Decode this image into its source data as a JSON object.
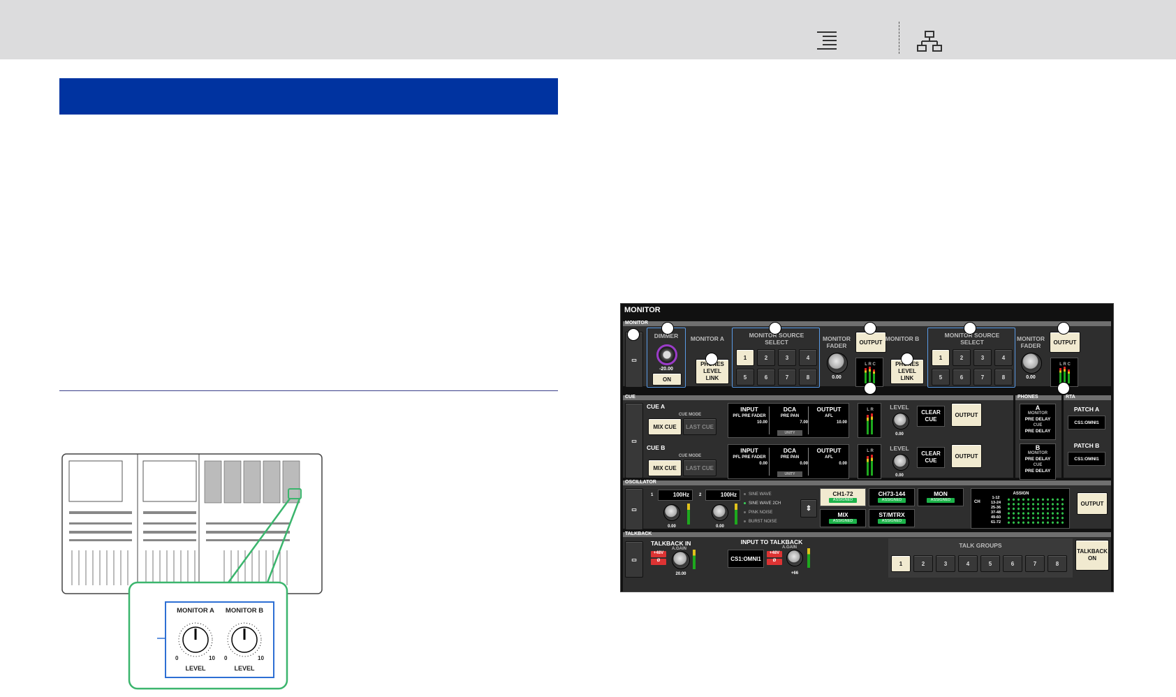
{
  "monitor": {
    "title": "MONITOR",
    "section_labels": {
      "monitor": "MONITOR",
      "cue": "CUE",
      "phones": "PHONES",
      "rta": "RTA",
      "oscillator": "OSCILLATOR",
      "talkback": "TALKBACK"
    },
    "dimmer": {
      "label": "DIMMER",
      "value": "-20.00",
      "on_label": "ON"
    },
    "monitor_a": {
      "label": "MONITOR A",
      "phones_link": "PHONES LEVEL LINK",
      "source_select_label": "MONITOR SOURCE SELECT",
      "sources": [
        "1",
        "2",
        "3",
        "4",
        "5",
        "6",
        "7",
        "8"
      ],
      "fader_label": "MONITOR FADER",
      "fader_value": "0.00",
      "output_label": "OUTPUT",
      "meter_label": "L R C"
    },
    "monitor_b": {
      "label": "MONITOR B",
      "phones_link": "PHONES LEVEL LINK",
      "source_select_label": "MONITOR SOURCE SELECT",
      "sources": [
        "1",
        "2",
        "3",
        "4",
        "5",
        "6",
        "7",
        "8"
      ],
      "fader_label": "MONITOR FADER",
      "fader_value": "0.00",
      "output_label": "OUTPUT",
      "meter_label": "L R C"
    },
    "cue_a": {
      "label": "CUE A",
      "mode_label": "CUE MODE",
      "mix_cue": "MIX CUE",
      "last_cue": "LAST CUE",
      "input_title": "INPUT",
      "input_sub": "PFL PRE FADER",
      "input_val": "10.00",
      "dca_title": "DCA",
      "dca_sub": "PRE PAN",
      "dca_val": "7.00",
      "unity": "UNITY",
      "output_title": "OUTPUT",
      "output_sub": "AFL",
      "output_val": "10.00",
      "meter_label": "L R",
      "level_label": "LEVEL",
      "level_value": "0.00",
      "clear_cue": "CLEAR CUE",
      "output_btn": "OUTPUT"
    },
    "cue_b": {
      "label": "CUE B",
      "mode_label": "CUE MODE",
      "mix_cue": "MIX CUE",
      "last_cue": "LAST CUE",
      "input_title": "INPUT",
      "input_sub": "PFL PRE FADER",
      "input_val": "0.00",
      "dca_title": "DCA",
      "dca_sub": "PRE PAN",
      "dca_val": "0.00",
      "unity": "UNITY",
      "output_title": "OUTPUT",
      "output_sub": "AFL",
      "output_val": "0.00",
      "meter_label": "L R",
      "level_label": "LEVEL",
      "level_value": "0.00",
      "clear_cue": "CLEAR CUE",
      "output_btn": "OUTPUT"
    },
    "phones": {
      "a": "A",
      "a_monitor": "MONITOR",
      "a_monitor_delay": "PRE DELAY",
      "a_cue": "CUE",
      "a_cue_delay": "PRE DELAY",
      "b": "B",
      "b_monitor": "MONITOR",
      "b_monitor_delay": "PRE DELAY",
      "b_cue": "CUE",
      "b_cue_delay": "PRE DELAY"
    },
    "rta": {
      "patch_a": "PATCH A",
      "patch_a_val": "CS1:OMNI1",
      "patch_b": "PATCH B",
      "patch_b_val": "CS1:OMNI1"
    },
    "oscillator": {
      "ch1_num": "1",
      "ch1_freq": "100Hz",
      "ch1_level": "0.00",
      "ch2_num": "2",
      "ch2_freq": "100Hz",
      "ch2_level": "0.00",
      "modes": [
        "SINE WAVE",
        "SINE WAVE 2CH",
        "PINK NOISE",
        "BURST NOISE"
      ],
      "groups": [
        {
          "name": "CH1-72",
          "tag": "ASSIGNED"
        },
        {
          "name": "CH73-144",
          "tag": "ASSIGNED"
        },
        {
          "name": "MON",
          "tag": "ASSIGNED"
        },
        {
          "name": "MIX",
          "tag": "ASSIGNED"
        },
        {
          "name": "ST/MTRX",
          "tag": "ASSIGNED"
        }
      ],
      "assign_label": "ASSIGN",
      "ch_label": "CH",
      "ranges": [
        "1-12",
        "13-24",
        "25-36",
        "37-48",
        "49-60",
        "61-72"
      ],
      "output_btn": "OUTPUT"
    },
    "talkback": {
      "in_label": "TALKBACK IN",
      "gain_label": "A.GAIN",
      "phantom": "+48V",
      "phase": "Ø",
      "in_gain": "20.00",
      "input_label": "INPUT TO TALKBACK",
      "input_val": "CS1:OMNI1",
      "input_gain_label": "A.GAIN",
      "input_phantom": "+48V",
      "input_phase": "Ø",
      "input_gain": "+66",
      "groups_label": "TALK GROUPS",
      "groups": [
        "1",
        "2",
        "3",
        "4",
        "5",
        "6",
        "7",
        "8"
      ],
      "on_btn": "TALKBACK ON"
    }
  },
  "console_figure": {
    "knob_a_label": "MONITOR A",
    "knob_b_label": "MONITOR B",
    "scale_min": "0",
    "scale_max": "10",
    "level_label": "LEVEL"
  }
}
